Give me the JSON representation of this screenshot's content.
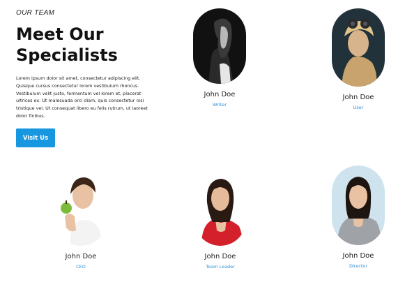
{
  "intro": {
    "eyebrow": "OUR TEAM",
    "title_line1": "Meet Our",
    "title_line2": "Specialists",
    "description": "Lorem ipsum dolor sit amet, consectetur adipiscing elit. Quisque cursus consectetur lorem vestibulum rhoncus. Vestibulum velit justo, fermentum vel lorem et, placerat ultrices ex. Ut malesuada orci diam, quis consectetur nisi tristique vel. Ut consequat libero eu felis rutrum, ut laoreet dolor finibus.",
    "button_label": "Visit Us"
  },
  "team": [
    {
      "name": "John Doe",
      "role": "Writer"
    },
    {
      "name": "John Doe",
      "role": "User"
    },
    {
      "name": "John Doe",
      "role": "CEO"
    },
    {
      "name": "John Doe",
      "role": "Team Leader"
    },
    {
      "name": "John Doe",
      "role": "Director"
    }
  ],
  "colors": {
    "accent": "#1697e0",
    "role_text": "#2d8ed8"
  }
}
